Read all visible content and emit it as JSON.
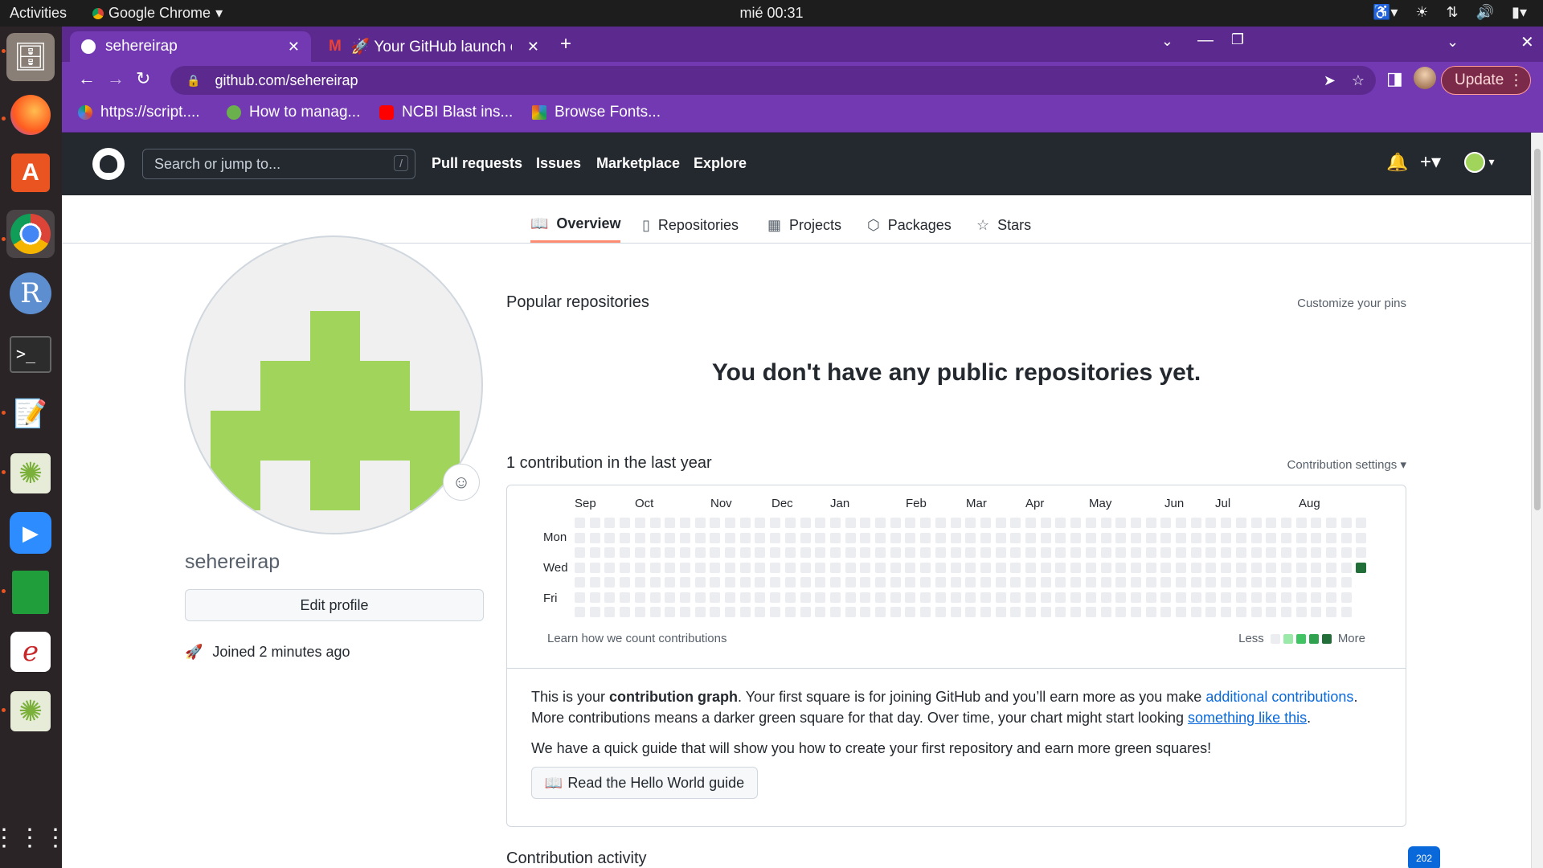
{
  "system": {
    "activities": "Activities",
    "app_name": "Google Chrome",
    "clock": "mié 00:31"
  },
  "chrome": {
    "tabs": [
      {
        "label": "sehereirap",
        "active": true
      },
      {
        "label": "🚀 Your GitHub launch co",
        "active": false
      }
    ],
    "url": "github.com/sehereirap",
    "update_label": "Update",
    "bookmarks": [
      {
        "label": "https://script...."
      },
      {
        "label": "How to manag..."
      },
      {
        "label": "NCBI Blast ins..."
      },
      {
        "label": "Browse Fonts..."
      }
    ]
  },
  "github": {
    "search_placeholder": "Search or jump to...",
    "search_key": "/",
    "nav": [
      "Pull requests",
      "Issues",
      "Marketplace",
      "Explore"
    ],
    "profile_tabs": [
      {
        "label": "Overview",
        "icon": "book-icon"
      },
      {
        "label": "Repositories",
        "icon": "repo-icon"
      },
      {
        "label": "Projects",
        "icon": "project-icon"
      },
      {
        "label": "Packages",
        "icon": "package-icon"
      },
      {
        "label": "Stars",
        "icon": "star-icon"
      }
    ],
    "username": "sehereirap",
    "edit_profile": "Edit profile",
    "joined": "Joined 2 minutes ago",
    "popular_title": "Popular repositories",
    "customize_pins": "Customize your pins",
    "no_repos": "You don't have any public repositories yet.",
    "contrib_title": "1 contribution in the last year",
    "contrib_settings": "Contribution settings ▾",
    "months": [
      "Sep",
      "Oct",
      "Nov",
      "Dec",
      "Jan",
      "Feb",
      "Mar",
      "Apr",
      "May",
      "Jun",
      "Jul",
      "Aug"
    ],
    "days": [
      "Mon",
      "Wed",
      "Fri"
    ],
    "learn": "Learn how we count contributions",
    "legend_less": "Less",
    "legend_more": "More",
    "legend_colors": [
      "#ebedf0",
      "#9be9a8",
      "#40c463",
      "#30a14e",
      "#216e39"
    ],
    "info": {
      "p1_a": "This is your ",
      "p1_bold": "contribution graph",
      "p1_b": ". Your first square is for joining GitHub and you’ll earn more as you make ",
      "p1_link": "additional contributions",
      "p1_c": ". More contributions means a darker green square for that day. Over time, your chart might start looking ",
      "p1_link2": "something like this",
      "p1_d": ".",
      "p2": "We have a quick guide that will show you how to create your first repository and earn more green squares!"
    },
    "hello_guide": "Read the Hello World guide",
    "activity_title": "Contribution activity",
    "year_label": "202"
  }
}
